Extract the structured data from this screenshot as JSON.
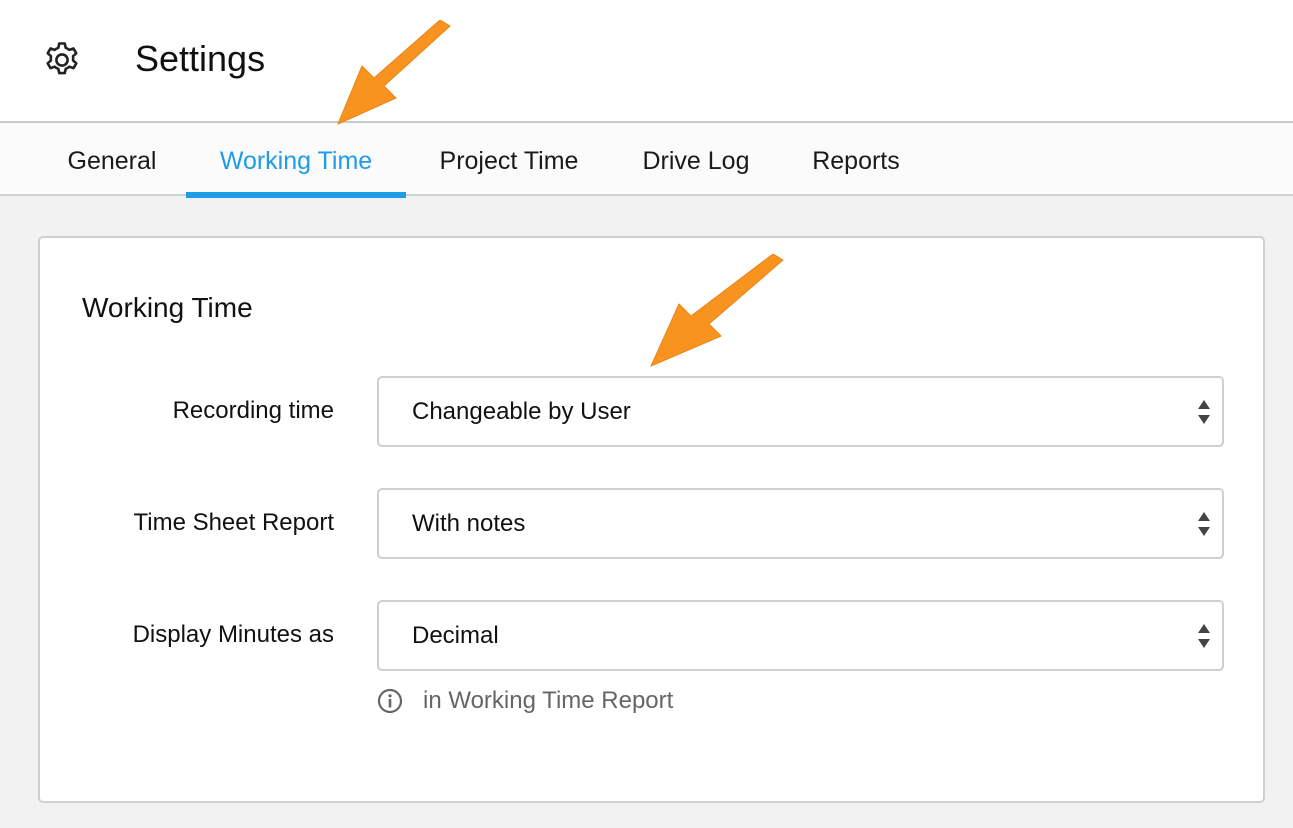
{
  "header": {
    "icon": "gear-icon",
    "title": "Settings"
  },
  "tabs": [
    {
      "label": "General",
      "active": false
    },
    {
      "label": "Working Time",
      "active": true
    },
    {
      "label": "Project Time",
      "active": false
    },
    {
      "label": "Drive Log",
      "active": false
    },
    {
      "label": "Reports",
      "active": false
    }
  ],
  "card": {
    "title": "Working Time",
    "rows": [
      {
        "label": "Recording time",
        "value": "Changeable by User"
      },
      {
        "label": "Time Sheet Report",
        "value": "With notes"
      },
      {
        "label": "Display Minutes as",
        "value": "Decimal"
      }
    ],
    "hint": {
      "icon": "info-icon",
      "text": "in Working Time Report"
    }
  },
  "colors": {
    "accent": "#1e9be9",
    "annotation_arrow": "#f7931e",
    "background": "#f2f2f2",
    "card_border": "#d0d0d0"
  }
}
